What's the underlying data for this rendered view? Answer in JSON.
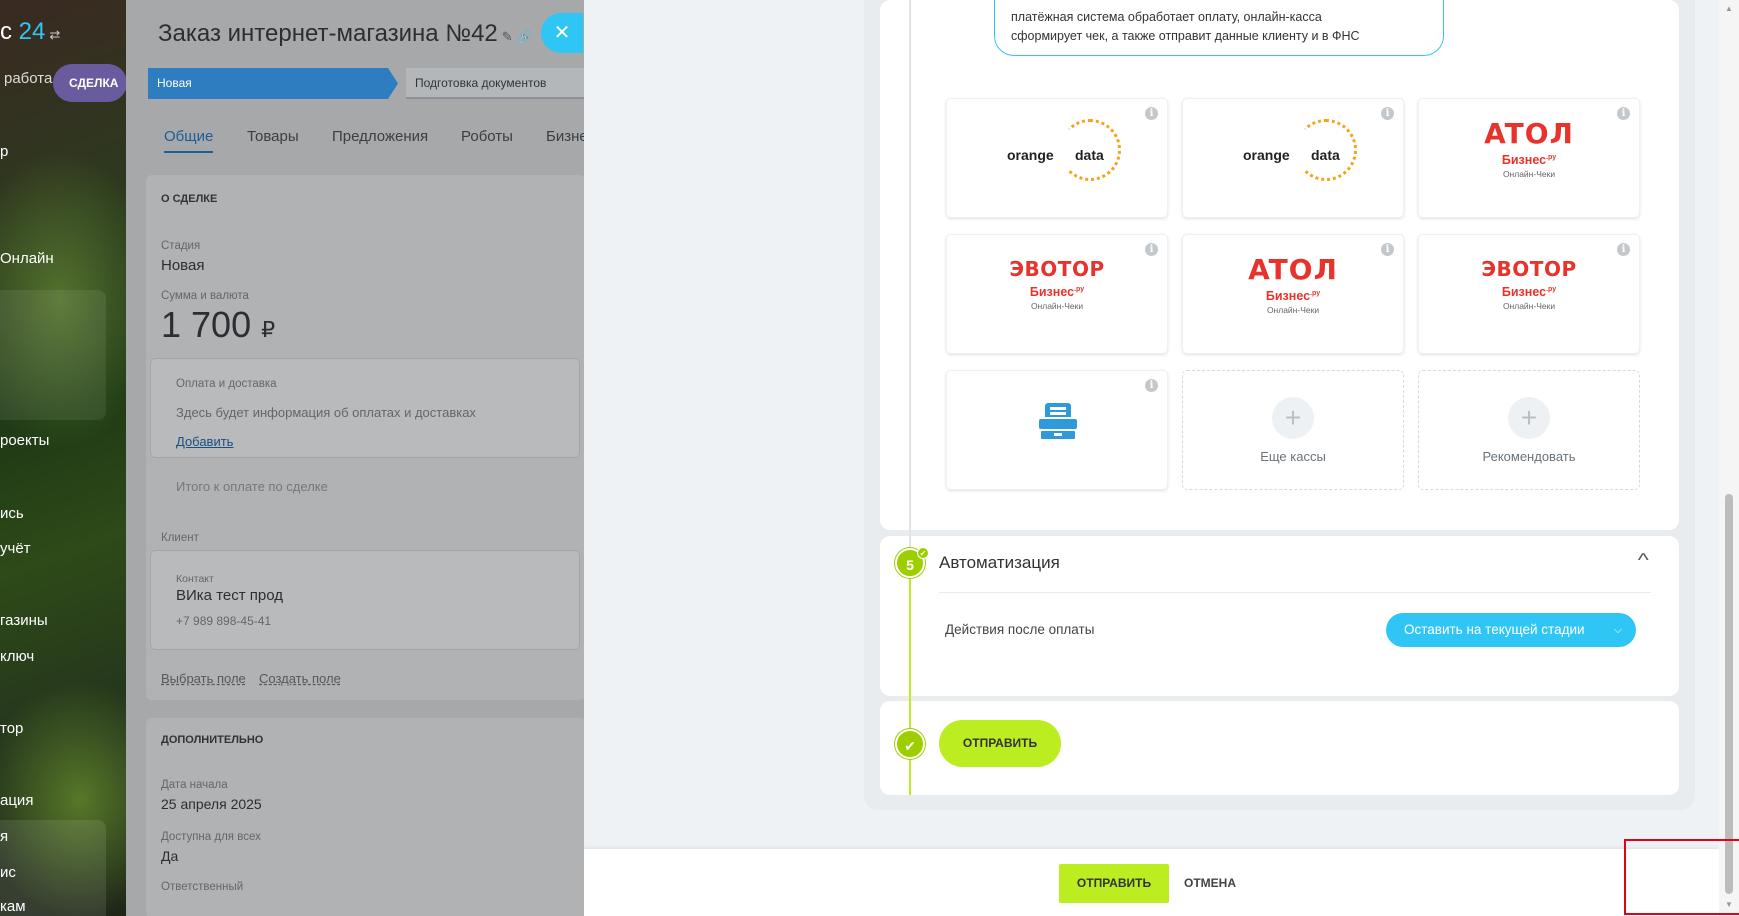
{
  "left_menu": {
    "logo_text": "с",
    "logo_num": "24",
    "logo_switch": "⇄",
    "subtitle": "работа",
    "deal_pill": "СДЕЛКА",
    "items": [
      "р",
      "Онлайн",
      "роекты",
      "ись",
      "учёт",
      "газины",
      "ключ",
      "тор",
      "ация",
      "я",
      "ис",
      "кам"
    ]
  },
  "deal": {
    "title": "Заказ интернет-магазина №42",
    "title_icons": "✎ 🔗",
    "stage_current": "Новая",
    "stage_next": "Подготовка документов",
    "tabs": [
      "Общие",
      "Товары",
      "Предложения",
      "Роботы",
      "Бизне"
    ],
    "section_about": "О СДЕЛКЕ",
    "stage_label": "Стадия",
    "stage_value": "Новая",
    "amount_label": "Сумма и валюта",
    "amount_value": "1 700",
    "amount_currency": "₽",
    "payment_label": "Оплата и доставка",
    "payment_text": "Здесь будет информация об оплатах и доставках",
    "payment_add": "Добавить",
    "total_label": "Итого к оплате по сделке",
    "client_label": "Клиент",
    "contact_label": "Контакт",
    "contact_name": "ВИка тест прод",
    "contact_phone": "+7 989 898-45-41",
    "choose_field": "Выбрать поле",
    "create_field": "Создать поле",
    "section_extra": "ДОПОЛНИТЕЛЬНО",
    "start_label": "Дата начала",
    "start_value": "25 апреля 2025",
    "access_label": "Доступна для всех",
    "access_value": "Да",
    "responsible_label": "Ответственный",
    "close": "✕"
  },
  "slider": {
    "bubble_line1": "платёжная система обработает оплату, онлайн-касса",
    "bubble_line2": "сформирует чек, а также отправит данные клиенту и в ФНС",
    "tiles": [
      {
        "kind": "orange",
        "left": "orange",
        "right": "data"
      },
      {
        "kind": "orange",
        "left": "orange",
        "right": "data"
      },
      {
        "kind": "atol",
        "brand": "ATOЛ",
        "sub": "Бизнес",
        "sup": ".ру",
        "sub2": "Онлайн-Чеки"
      },
      {
        "kind": "evo",
        "brand": "ЭВОТОР",
        "sub": "Бизнес",
        "sup": ".ру",
        "sub2": "Онлайн-Чеки"
      },
      {
        "kind": "atol",
        "brand": "ATOЛ",
        "sub": "Бизнес",
        "sup": ".ру",
        "sub2": "Онлайн-Чеки"
      },
      {
        "kind": "evo",
        "brand": "ЭВОТОР",
        "sub": "Бизнес",
        "sup": ".ру",
        "sub2": "Онлайн-Чеки"
      },
      {
        "kind": "register"
      },
      {
        "kind": "more",
        "label": "Еще кассы",
        "plus": "+"
      },
      {
        "kind": "more",
        "label": "Рекомендовать",
        "plus": "+"
      }
    ],
    "info_glyph": "i",
    "step_number": "5",
    "step_title": "Автоматизация",
    "collapse_glyph": "^",
    "after_payment_label": "Действия после оплаты",
    "after_payment_value": "Оставить на текущей стадии",
    "select_arrow": "⌵",
    "inner_send": "ОТПРАВИТЬ",
    "check_glyph": "✔"
  },
  "footer": {
    "send": "ОТПРАВИТЬ",
    "cancel": "ОТМЕНА"
  },
  "colors": {
    "accent_blue": "#2fc6f6",
    "accent_green": "#bbed21",
    "step_green": "#9dcf00",
    "highlight_red": "#e2001a"
  }
}
